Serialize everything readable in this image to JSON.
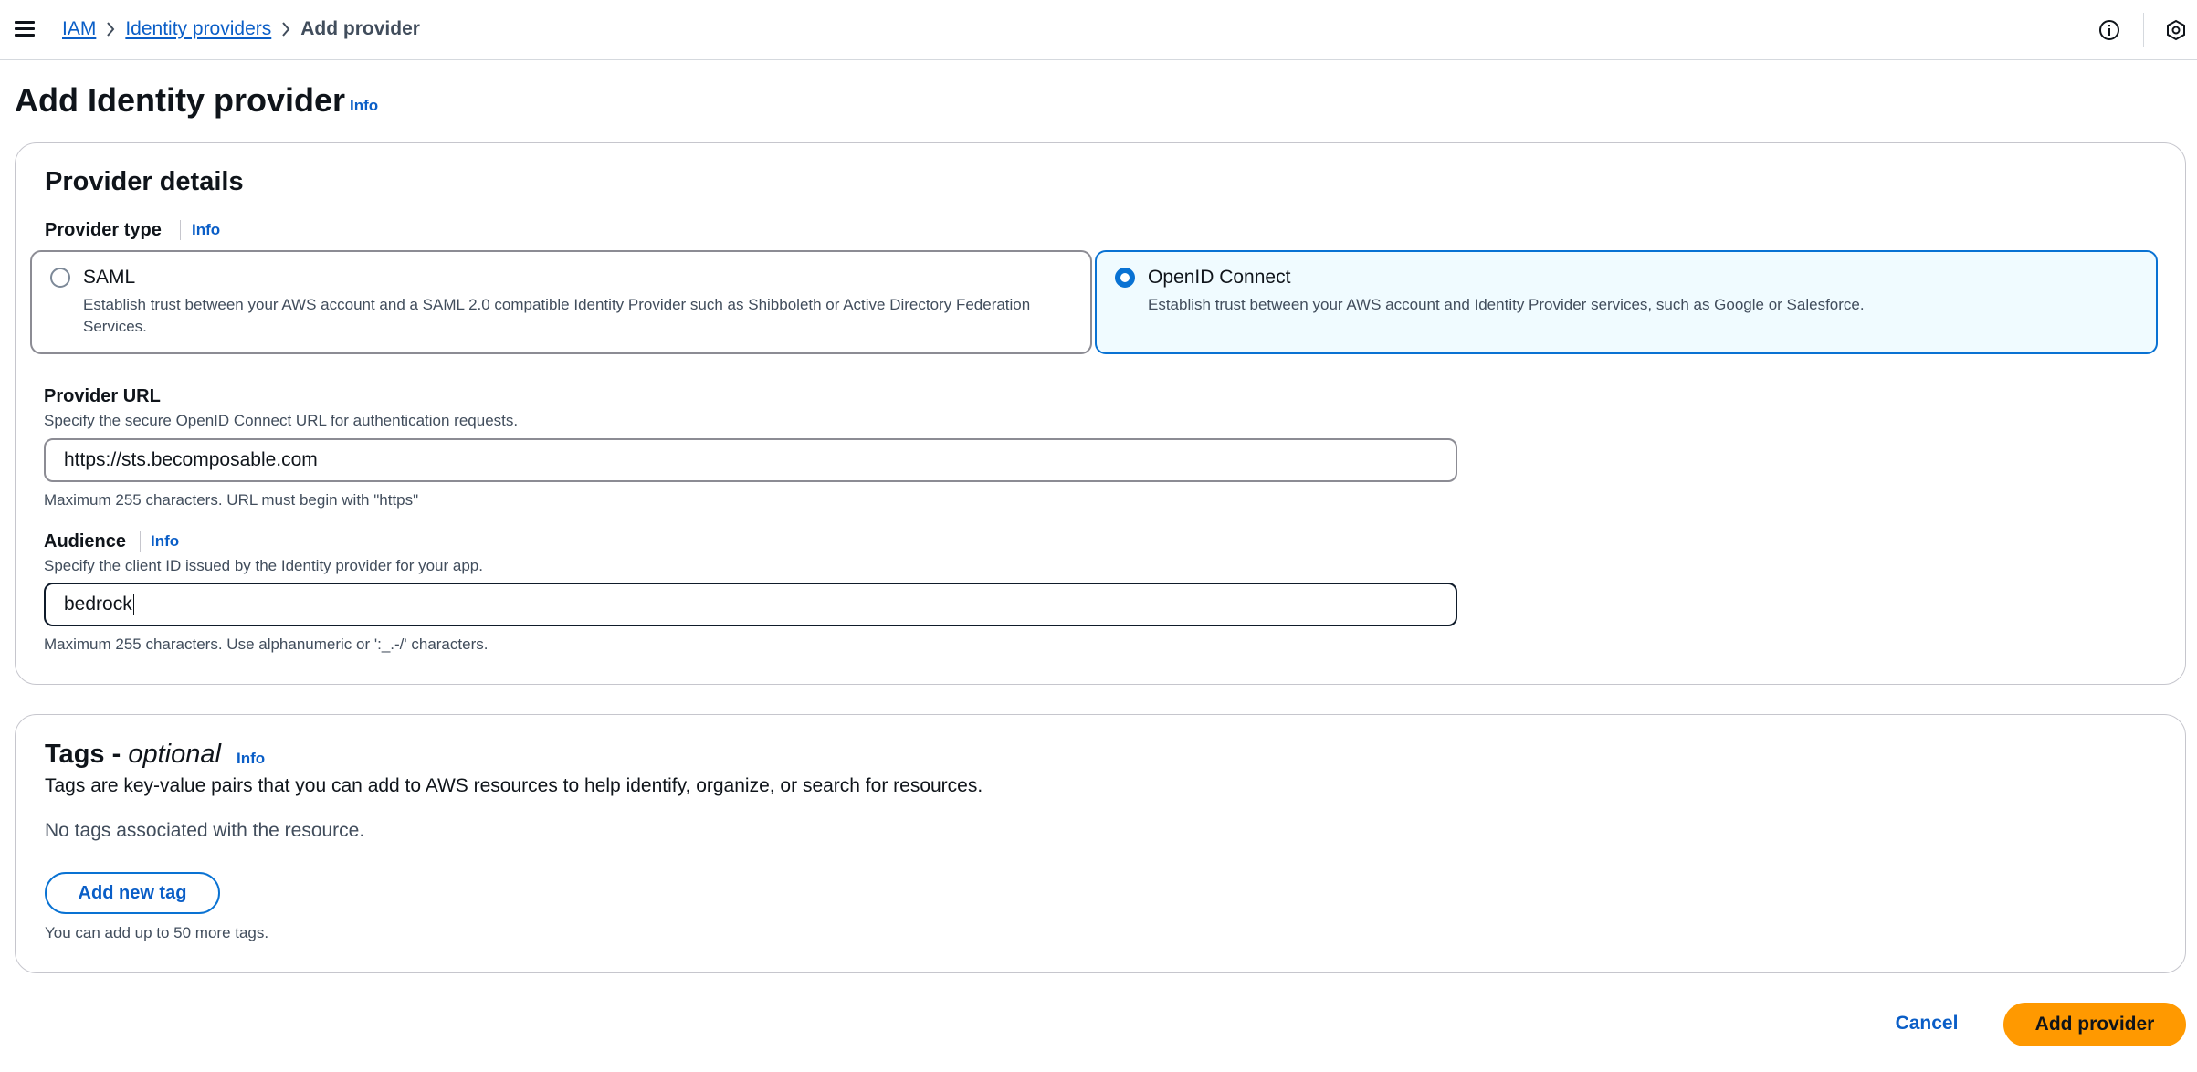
{
  "topbar": {
    "menu_icon": "hamburger-menu-icon",
    "breadcrumbs": [
      {
        "label": "IAM"
      },
      {
        "label": "Identity providers"
      },
      {
        "label": "Add provider"
      }
    ],
    "info_icon": "info-circle-icon",
    "settings_icon": "settings-hex-icon"
  },
  "page": {
    "title": "Add Identity provider",
    "info_label": "Info"
  },
  "provider_details": {
    "heading": "Provider details",
    "provider_type": {
      "label": "Provider type",
      "info_label": "Info",
      "options": [
        {
          "title": "SAML",
          "description": "Establish trust between your AWS account and a SAML 2.0 compatible Identity Provider such as Shibboleth or Active Directory Federation Services.",
          "selected": false
        },
        {
          "title": "OpenID Connect",
          "description": "Establish trust between your AWS account and Identity Provider services, such as Google or Salesforce.",
          "selected": true
        }
      ]
    },
    "provider_url": {
      "label": "Provider URL",
      "description": "Specify the secure OpenID Connect URL for authentication requests.",
      "value": "https://sts.becomposable.com",
      "constraint": "Maximum 255 characters. URL must begin with \"https\""
    },
    "audience": {
      "label": "Audience",
      "info_label": "Info",
      "description": "Specify the client ID issued by the Identity provider for your app.",
      "value": "bedrock",
      "constraint": "Maximum 255 characters. Use alphanumeric or ':_.-/' characters."
    }
  },
  "tags": {
    "heading": "Tags - ",
    "heading_optional": "optional",
    "info_label": "Info",
    "description": "Tags are key-value pairs that you can add to AWS resources to help identify, organize, or search for resources.",
    "empty_text": "No tags associated with the resource.",
    "add_button": "Add new tag",
    "limit_text": "You can add up to 50 more tags."
  },
  "footer": {
    "cancel_label": "Cancel",
    "submit_label": "Add provider"
  },
  "colors": {
    "link": "#0a5ec7",
    "accent": "#0972d3",
    "primary_button": "#ff9900",
    "selected_tile_bg": "#f0fbff"
  }
}
